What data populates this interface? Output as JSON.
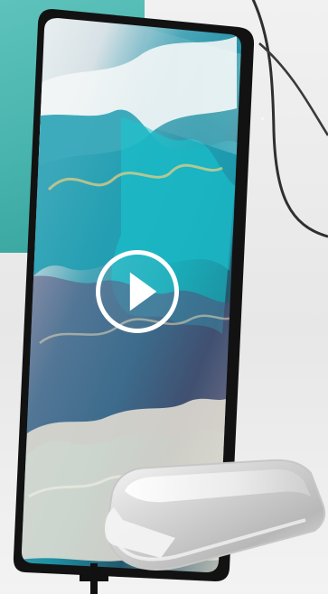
{
  "scene": {
    "accent_color": "#3fb1aa",
    "frame_color": "#151515",
    "screen_palette": [
      "#1cb4c2",
      "#123a5a",
      "#5b4c78",
      "#d8d2c8",
      "#f0e6cf"
    ]
  },
  "phone": {
    "media_control": "play-icon"
  },
  "icons": [
    "play-icon",
    "plus-icon"
  ]
}
